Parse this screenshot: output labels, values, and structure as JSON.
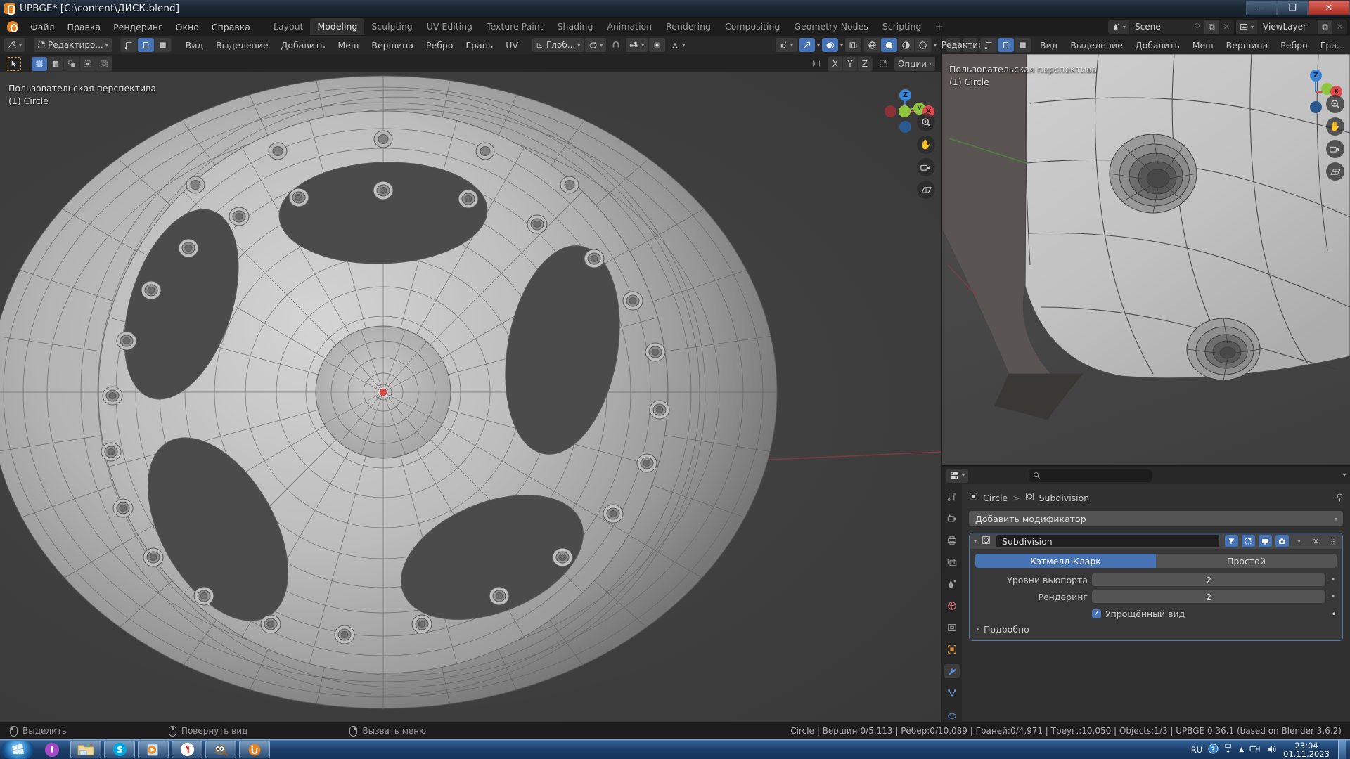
{
  "window": {
    "title": "UPBGE* [C:\\content\\ДИСК.blend]",
    "app_icon": "blender-icon",
    "buttons": {
      "minimize": "—",
      "maximize": "❐",
      "close": "✕"
    }
  },
  "topbar": {
    "menus": [
      "Файл",
      "Правка",
      "Рендеринг",
      "Окно",
      "Справка"
    ],
    "workspaces": [
      {
        "label": "Layout",
        "active": false
      },
      {
        "label": "Modeling",
        "active": true
      },
      {
        "label": "Sculpting",
        "active": false
      },
      {
        "label": "UV Editing",
        "active": false
      },
      {
        "label": "Texture Paint",
        "active": false
      },
      {
        "label": "Shading",
        "active": false
      },
      {
        "label": "Animation",
        "active": false
      },
      {
        "label": "Rendering",
        "active": false
      },
      {
        "label": "Compositing",
        "active": false
      },
      {
        "label": "Geometry Nodes",
        "active": false
      },
      {
        "label": "Scripting",
        "active": false
      }
    ],
    "add_workspace": "+",
    "scene": {
      "icon": "scene-icon",
      "value": "Scene",
      "pin": "pin-icon",
      "new": "copy-icon",
      "unlink": "✕"
    },
    "viewlayer": {
      "icon": "viewlayer-icon",
      "value": "ViewLayer",
      "new": "copy-icon",
      "unlink": "✕"
    }
  },
  "viewport_left": {
    "header": {
      "editor_type": "editor-type-3dview",
      "mode": "Редактиро...",
      "select_modes": [
        "vertex-select",
        "edge-select",
        "face-select"
      ],
      "active_select_mode": 1,
      "menus": [
        "Вид",
        "Выделение",
        "Добавить",
        "Меш",
        "Вершина",
        "Ребро",
        "Грань",
        "UV"
      ],
      "transform_orientation": "Глоб...",
      "pivot": "pivot-icon",
      "snap": "magnet-icon",
      "snap_target": "snap-increment-icon",
      "proportional": "proportional-icon",
      "falloff": "falloff-smooth-icon",
      "visibility": "visibility-icon",
      "gizmo": "gizmo-icon",
      "overlays": "overlays-icon",
      "xray": "xray-icon",
      "shading": [
        "wireframe-shading",
        "solid-shading",
        "material-shading",
        "rendered-shading"
      ],
      "active_shading": 1
    },
    "toolbar": {
      "active_tool": "tweak-tool",
      "select_modes": [
        "select-box",
        "select-circle",
        "select-lasso",
        "select-extend",
        "select-difference"
      ],
      "active_index": 0
    },
    "options_row": {
      "mirror_icon": "mirror-icon",
      "axes": [
        "X",
        "Y",
        "Z"
      ],
      "topology_mirror": "topology-mirror-icon",
      "options": "Опции"
    },
    "overlay_text": [
      "Пользовательская перспектива",
      "(1) Circle"
    ],
    "gizmo_axes": {
      "z": "Z",
      "y": "Y",
      "x": "X",
      "colors": {
        "x": "#e0474c",
        "y": "#8ec640",
        "z": "#3a84d6"
      }
    },
    "nav_buttons": [
      "zoom-icon",
      "pan-icon",
      "camera-icon",
      "ortho-persp-icon"
    ]
  },
  "viewport_right": {
    "header": {
      "editor_type": "editor-type-3dview",
      "mode": "Редактиро...",
      "menus": [
        "Вид",
        "Выделение",
        "Добавить",
        "Меш",
        "Вершина",
        "Ребро",
        "Гра..."
      ]
    },
    "overlay_text": [
      "Пользовательская перспектива",
      "(1) Circle"
    ],
    "nav_buttons": [
      "zoom-icon",
      "pan-icon",
      "camera-icon",
      "ortho-persp-icon"
    ]
  },
  "properties": {
    "editor_icon": "properties-editor-icon",
    "search_placeholder": "",
    "tabs": [
      {
        "name": "tool",
        "icon": "tool-icon",
        "active": false
      },
      {
        "name": "render",
        "icon": "render-icon",
        "active": false
      },
      {
        "name": "output",
        "icon": "printer-icon",
        "active": false
      },
      {
        "name": "view-layer",
        "icon": "images-icon",
        "active": false
      },
      {
        "name": "scene",
        "icon": "scene-cone-icon",
        "active": false
      },
      {
        "name": "world",
        "icon": "world-icon",
        "active": false
      },
      {
        "name": "collection",
        "icon": "collection-icon",
        "active": false
      },
      {
        "name": "object",
        "icon": "object-icon",
        "active": false
      },
      {
        "name": "modifiers",
        "icon": "wrench-icon",
        "active": true
      },
      {
        "name": "particles",
        "icon": "particles-icon",
        "active": false
      },
      {
        "name": "physics",
        "icon": "physics-icon",
        "active": false
      }
    ],
    "breadcrumb": [
      {
        "icon": "object-data-icon",
        "label": "Circle"
      },
      {
        "icon": "modifier-icon",
        "label": "Subdivision"
      }
    ],
    "breadcrumb_sep": ">",
    "pin_icon": "pin-icon",
    "add_modifier": "Добавить модификатор",
    "modifier": {
      "name": "Subdivision",
      "icon": "subdivision-icon",
      "expand_icon": "chevron-down-icon",
      "toggles": [
        {
          "name": "on-cage",
          "icon": "on-cage-icon",
          "on": true
        },
        {
          "name": "edit-mode-display",
          "icon": "edit-mode-icon",
          "on": true
        },
        {
          "name": "realtime-display",
          "icon": "display-icon",
          "on": true
        },
        {
          "name": "render-display",
          "icon": "camera-icon",
          "on": true
        }
      ],
      "extras_icon": "chevron-down-icon",
      "close_icon": "✕",
      "drag_icon": "::::",
      "algorithm_options": [
        {
          "label": "Кэтмелл-Кларк",
          "active": true
        },
        {
          "label": "Простой",
          "active": false
        }
      ],
      "fields": [
        {
          "label": "Уровни вьюпорта",
          "value": "2"
        },
        {
          "label": "Рендеринг",
          "value": "2"
        }
      ],
      "checkbox": {
        "label": "Упрощённый вид",
        "checked": true
      },
      "advanced": "Подробно"
    }
  },
  "statusbar": {
    "hints": [
      {
        "mouse": "left",
        "label": "Выделить"
      },
      {
        "mouse": "middle",
        "label": "Повернуть вид"
      },
      {
        "mouse": "right",
        "label": "Вызвать меню"
      }
    ],
    "stats": "Circle | Вершин:0/5,113 | Рёбер:0/10,089 | Граней:0/4,971 | Треуг.:10,050 | Objects:1/3 | UPBGE 0.36.1 (based on Blender 3.6.2)"
  },
  "taskbar": {
    "start": "windows-start-orb",
    "items": [
      {
        "name": "ubuntu-icon"
      },
      {
        "name": "file-explorer-icon"
      },
      {
        "name": "skype-icon"
      },
      {
        "name": "media-player-icon"
      },
      {
        "name": "yandex-browser-icon"
      },
      {
        "name": "gimp-icon"
      },
      {
        "name": "upbge-icon"
      }
    ],
    "tray": {
      "language": "RU",
      "help_icon": "help-icon",
      "action_center_icon": "action-center-icon",
      "show_hidden_icon": "▲",
      "network_icon": "network-icon",
      "volume_icon": "volume-icon",
      "time": "23:04",
      "date": "01.11.2023"
    }
  }
}
